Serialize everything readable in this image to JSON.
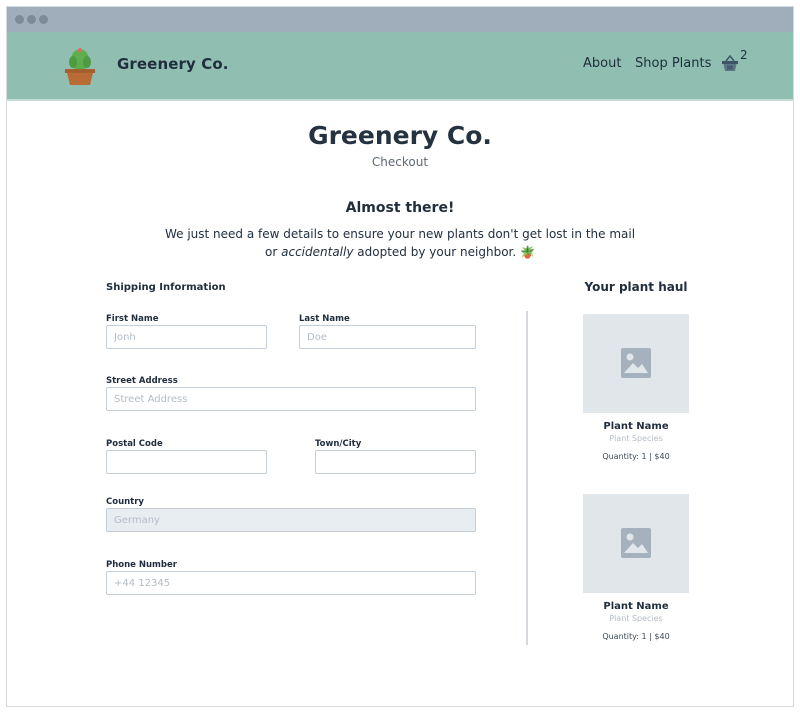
{
  "navbar": {
    "brand": "Greenery Co.",
    "links": [
      {
        "label": "About"
      },
      {
        "label": "Shop Plants"
      }
    ],
    "cart": {
      "icon": "basket-icon",
      "count": "2"
    },
    "logo_icon": "cactus-pot-icon"
  },
  "header": {
    "title": "Greenery Co.",
    "subtitle": "Checkout"
  },
  "intro": {
    "heading": "Almost there!",
    "line1": "We just need a few details to ensure your new plants don't get lost in the mail",
    "line2_prefix": "or ",
    "line2_emphasis": "accidentally",
    "line2_suffix": " adopted by your neighbor. 🪴"
  },
  "shipping": {
    "title": "Shipping Information",
    "first_name": {
      "label": "First Name",
      "placeholder": "Jonh",
      "value": ""
    },
    "last_name": {
      "label": "Last Name",
      "placeholder": "Doe",
      "value": ""
    },
    "street": {
      "label": "Street Address",
      "placeholder": "Street Address",
      "value": ""
    },
    "postal": {
      "label": "Postal Code",
      "placeholder": "",
      "value": ""
    },
    "city": {
      "label": "Town/City",
      "placeholder": "",
      "value": ""
    },
    "country": {
      "label": "Country",
      "placeholder": "Germany",
      "value": ""
    },
    "phone": {
      "label": "Phone Number",
      "placeholder": "+44 12345",
      "value": ""
    }
  },
  "haul": {
    "title": "Your plant haul",
    "items": [
      {
        "name": "Plant Name",
        "species": "Plant Species",
        "qty": "Quantity: 1 | $40",
        "icon": "image-placeholder-icon"
      },
      {
        "name": "Plant Name",
        "species": "Plant Species",
        "qty": "Quantity: 1 | $40",
        "icon": "image-placeholder-icon"
      }
    ]
  },
  "colors": {
    "navbar_bg": "#90bfb2",
    "chrome_bg": "#a0aebb",
    "text_dark": "#1f2d3d",
    "input_border": "#c4ced8",
    "disabled_bg": "#e8edf2",
    "placeholder_bg": "#e1e6eb"
  }
}
